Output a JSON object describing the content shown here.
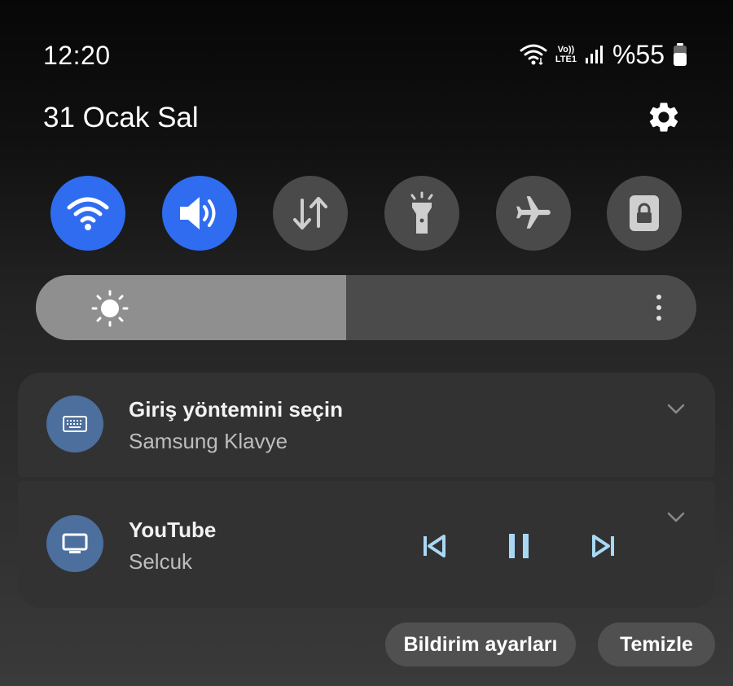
{
  "status_bar": {
    "time": "12:20",
    "volte_top": "Vo))",
    "volte_bottom": "LTE1",
    "battery": "%55",
    "icons": [
      "wifi-icon",
      "volte-lte-icon",
      "signal-icon",
      "battery-icon"
    ]
  },
  "header": {
    "date": "31 Ocak Sal",
    "settings_icon": "gear-icon"
  },
  "quick_toggles": [
    {
      "name": "wifi",
      "icon": "wifi-icon",
      "state": "on"
    },
    {
      "name": "sound",
      "icon": "speaker-icon",
      "state": "on"
    },
    {
      "name": "mobile-data",
      "icon": "data-arrows-icon",
      "state": "off"
    },
    {
      "name": "flashlight",
      "icon": "flashlight-icon",
      "state": "off"
    },
    {
      "name": "airplane-mode",
      "icon": "airplane-icon",
      "state": "off"
    },
    {
      "name": "screen-lock",
      "icon": "lock-icon",
      "state": "off"
    }
  ],
  "brightness": {
    "level": 0.47,
    "icon": "sun-icon",
    "menu_icon": "more-vertical-icon"
  },
  "notifications": [
    {
      "title": "Giriş yöntemini seçin",
      "subtitle": "Samsung Klavye",
      "icon": "keyboard-icon"
    },
    {
      "title": "YouTube",
      "subtitle": "Selcuk",
      "icon": "tv-icon",
      "controls": [
        "previous-icon",
        "pause-icon",
        "next-icon"
      ]
    }
  ],
  "actions": {
    "settings_label": "Bildirim ayarları",
    "clear_label": "Temizle"
  },
  "colors": {
    "toggle_on": "#2f6cf0",
    "toggle_off": "#4a4a4a",
    "app_icon_bg": "#4d6f9e",
    "media_control": "#a9d8f5"
  }
}
